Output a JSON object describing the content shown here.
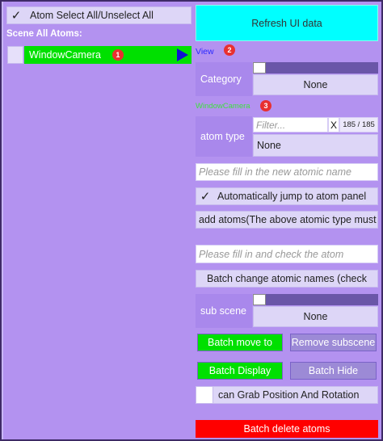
{
  "left_panel": {
    "select_all_check": "✓",
    "select_all_label": "Atom Select All/Unselect All",
    "scene_heading": "Scene All Atoms:",
    "atom_row": {
      "name": "WindowCamera",
      "badge": "1"
    }
  },
  "right_panel": {
    "refresh_label": "Refresh UI data",
    "view_link": "View",
    "badge_2": "2",
    "category": {
      "label": "Category",
      "value": "None",
      "slider_fraction": 0.0
    },
    "selected_atom": "WindowCamera",
    "badge_3": "3",
    "atom_type": {
      "label": "atom type",
      "filter_placeholder": "Filter...",
      "clear_label": "X",
      "count": "185 / 185",
      "value": "None"
    },
    "new_name_placeholder": "Please fill in the new atomic name",
    "auto_jump": {
      "check": "✓",
      "label": "Automatically jump to atom panel"
    },
    "add_atoms_label": "add atoms(The above atomic type must",
    "check_atom_placeholder": "Please fill in and check the atom",
    "batch_change_label": "Batch change atomic names (check",
    "sub_scene": {
      "label": "sub scene",
      "value": "None",
      "slider_fraction": 0.0
    },
    "batch_move_label": "Batch move to",
    "remove_subscene_label": "Remove subscene",
    "batch_display_label": "Batch Display",
    "batch_hide_label": "Batch Hide",
    "grab_label": "can Grab Position And Rotation",
    "batch_delete_label": "Batch delete atoms"
  },
  "colors": {
    "panel_bg": "#b392f0",
    "refresh_bg": "#00ffff",
    "green": "#00e000",
    "delete_red": "#ff0000",
    "link_blue": "#2a2aff",
    "selected_atom_green": "#40e040",
    "badge_red": "#e83030"
  },
  "icons": {
    "play": "play-triangle-icon",
    "check": "checkmark-icon"
  }
}
